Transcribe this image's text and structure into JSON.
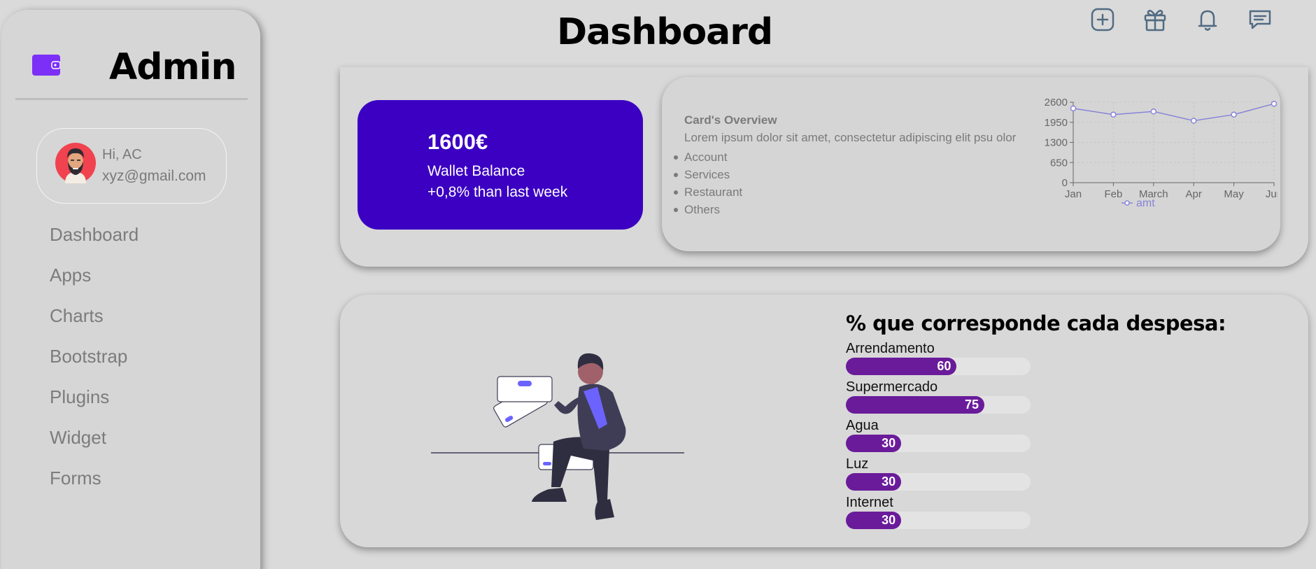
{
  "sidebar": {
    "brand_title": "Admin",
    "profile": {
      "greeting": "Hi, AC",
      "email": "xyz@gmail.com"
    },
    "items": [
      {
        "label": "Dashboard"
      },
      {
        "label": "Apps"
      },
      {
        "label": "Charts"
      },
      {
        "label": "Bootstrap"
      },
      {
        "label": "Plugins"
      },
      {
        "label": "Widget"
      },
      {
        "label": "Forms"
      }
    ]
  },
  "header": {
    "title": "Dashboard",
    "icons": [
      "plus-square-icon",
      "gift-icon",
      "bell-icon",
      "message-icon"
    ]
  },
  "wallet": {
    "amount": "1600€",
    "label": "Wallet Balance",
    "change": "+0,8% than last week"
  },
  "overview": {
    "title": "Card's Overview",
    "text": "Lorem ipsum dolor sit amet, consectetur adipiscing elit psu olor",
    "items": [
      "Account",
      "Services",
      "Restaurant",
      "Others"
    ]
  },
  "chart_data": {
    "type": "line",
    "categories": [
      "Jan",
      "Feb",
      "March",
      "Apr",
      "May",
      "Jun"
    ],
    "series": [
      {
        "name": "amt",
        "values": [
          2400,
          2200,
          2300,
          2000,
          2200,
          2550
        ]
      }
    ],
    "ylim": [
      0,
      2600
    ],
    "yticks": [
      "0",
      "650",
      "1300",
      "1950",
      "2600"
    ],
    "title": "",
    "xlabel": "",
    "ylabel": "",
    "grid": true,
    "legend": "bottom",
    "color": "#8884d8"
  },
  "expenses": {
    "title": "% que corresponde cada despesa:",
    "items": [
      {
        "label": "Arrendamento",
        "value": "60",
        "pct": 60
      },
      {
        "label": "Supermercado",
        "value": "75",
        "pct": 75
      },
      {
        "label": "Agua",
        "value": "30",
        "pct": 30
      },
      {
        "label": "Luz",
        "value": "30",
        "pct": 30
      },
      {
        "label": "Internet",
        "value": "30",
        "pct": 30
      }
    ],
    "fill_color": "#6a1b9a"
  }
}
